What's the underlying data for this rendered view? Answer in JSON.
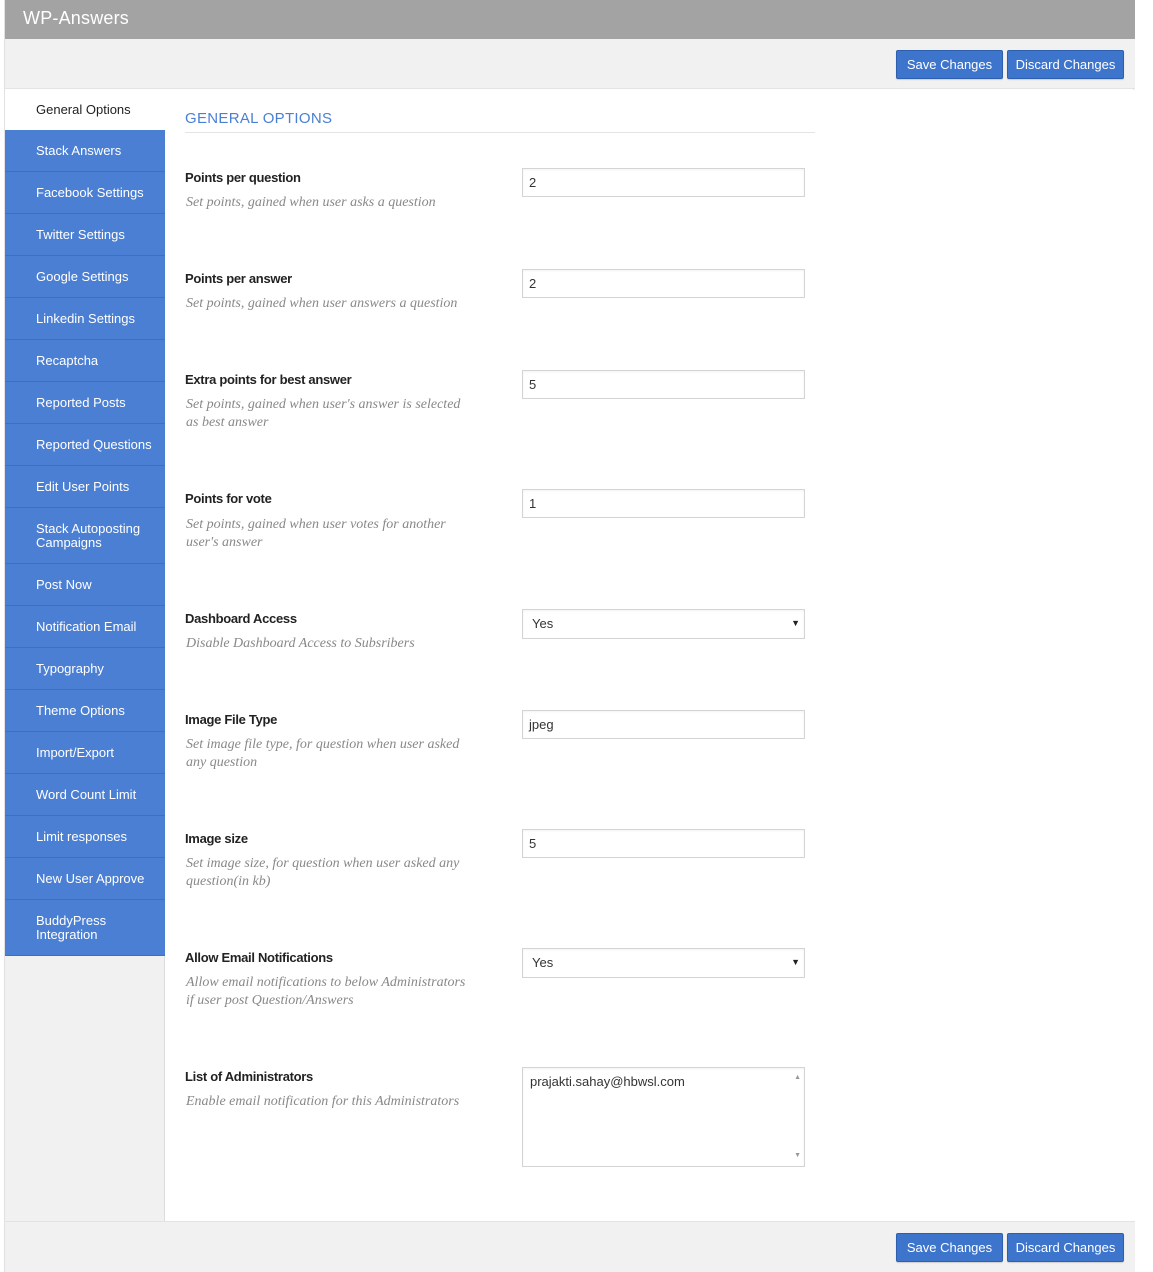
{
  "app": {
    "title": "WP-Answers"
  },
  "toolbar": {
    "save_label": "Save Changes",
    "discard_label": "Discard Changes"
  },
  "sidebar": {
    "items": [
      {
        "label": "General Options",
        "active": true
      },
      {
        "label": "Stack Answers"
      },
      {
        "label": "Facebook Settings"
      },
      {
        "label": "Twitter Settings"
      },
      {
        "label": "Google Settings"
      },
      {
        "label": "Linkedin Settings"
      },
      {
        "label": "Recaptcha"
      },
      {
        "label": "Reported Posts"
      },
      {
        "label": "Reported Questions"
      },
      {
        "label": "Edit User Points"
      },
      {
        "label": "Stack Autoposting Campaigns"
      },
      {
        "label": "Post Now"
      },
      {
        "label": "Notification Email"
      },
      {
        "label": "Typography"
      },
      {
        "label": "Theme Options"
      },
      {
        "label": "Import/Export"
      },
      {
        "label": "Word Count Limit"
      },
      {
        "label": "Limit responses"
      },
      {
        "label": "New User Approve"
      },
      {
        "label": "BuddyPress Integration"
      }
    ]
  },
  "main": {
    "section_title": "GENERAL OPTIONS",
    "options": [
      {
        "label": "Points per question",
        "description": "Set points, gained when user asks a question",
        "value": "2"
      },
      {
        "label": "Points per answer",
        "description": "Set points, gained when user answers a question",
        "value": "2"
      },
      {
        "label": "Extra points for best answer",
        "description": "Set points, gained when user's answer is selected as best answer",
        "value": "5"
      },
      {
        "label": "Points for vote",
        "description": "Set points, gained when user votes for another user's answer",
        "value": "1"
      },
      {
        "label": "Dashboard Access",
        "description": "Disable Dashboard Access to Subsribers",
        "value": "Yes"
      },
      {
        "label": "Image File Type",
        "description": "Set image file type, for question when user asked any question",
        "value": "jpeg"
      },
      {
        "label": "Image size",
        "description": "Set image size, for question when user asked any question(in kb)",
        "value": "5"
      },
      {
        "label": "Allow Email Notifications",
        "description": "Allow email notifications to below Administrators if user post Question/Answers",
        "value": "Yes"
      },
      {
        "label": "List of Administrators",
        "description": "Enable email notification for this Administrators",
        "value": "prajakti.sahay@hbwsl.com"
      }
    ]
  },
  "icons": {
    "select_arrow": "chevron-down-icon",
    "scroll_up": "scroll-up-arrow-icon",
    "scroll_down": "scroll-down-arrow-icon"
  },
  "colors": {
    "accent": "#4a7fd4",
    "button": "#3d74cc",
    "titlebar": "#a3a3a3"
  }
}
